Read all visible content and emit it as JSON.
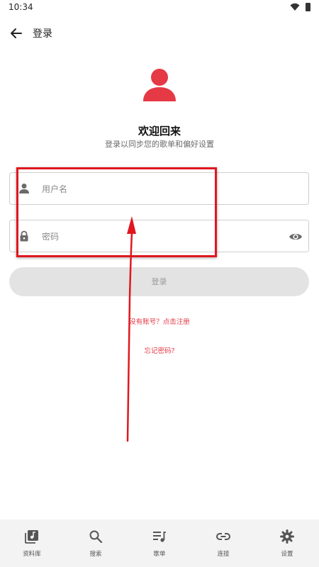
{
  "status_bar": {
    "time": "10:34"
  },
  "app_bar": {
    "title": "登录"
  },
  "welcome": {
    "title": "欢迎回来",
    "subtitle": "登录以同步您的歌单和偏好设置"
  },
  "form": {
    "username_placeholder": "用户名",
    "password_placeholder": "密码",
    "login_label": "登录"
  },
  "links": {
    "register": "没有账号？点击注册",
    "forgot": "忘记密码?"
  },
  "bottom_nav": {
    "items": [
      {
        "label": "资料库",
        "icon": "library-music-icon"
      },
      {
        "label": "搜索",
        "icon": "search-icon"
      },
      {
        "label": "歌单",
        "icon": "playlist-icon"
      },
      {
        "label": "连接",
        "icon": "link-icon"
      },
      {
        "label": "设置",
        "icon": "settings-gear-icon"
      }
    ]
  },
  "colors": {
    "accent": "#e53945",
    "annotation": "#e0171f",
    "button_disabled": "#e3e3e3",
    "nav_background": "#f3f3f3"
  }
}
